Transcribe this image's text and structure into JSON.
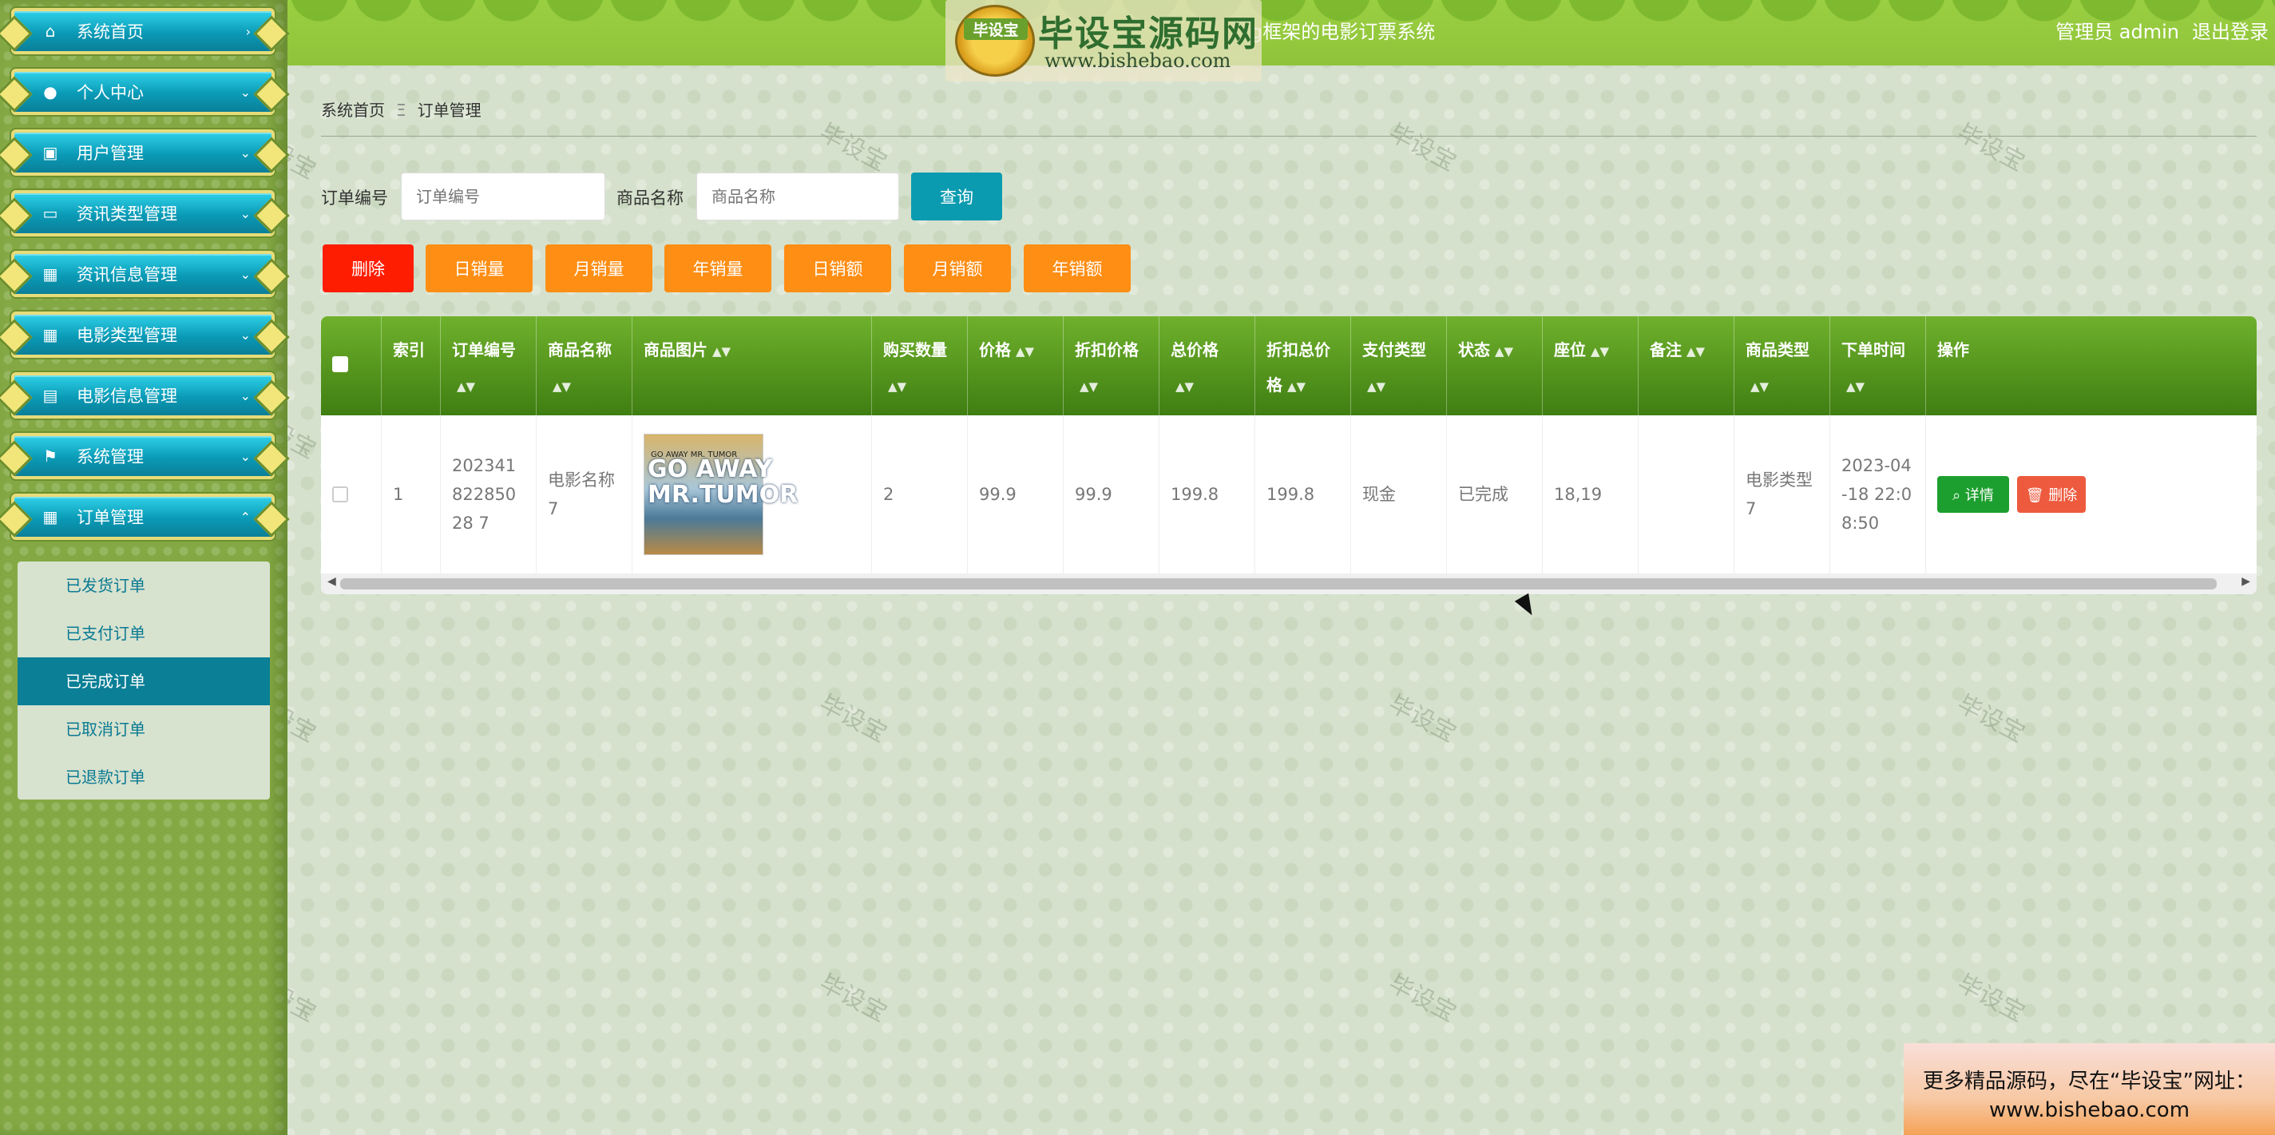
{
  "header": {
    "system_title": "g框架的电影订票系统",
    "admin_label": "管理员 admin",
    "logout": "退出登录"
  },
  "logo": {
    "badge": "毕设宝",
    "title": "毕设宝源码网",
    "url": "www.bishebao.com"
  },
  "sidebar": {
    "items": [
      {
        "label": "系统首页",
        "icon": "home-icon"
      },
      {
        "label": "个人中心",
        "icon": "user-icon"
      },
      {
        "label": "用户管理",
        "icon": "briefcase-icon"
      },
      {
        "label": "资讯类型管理",
        "icon": "monitor-icon"
      },
      {
        "label": "资讯信息管理",
        "icon": "grid-icon"
      },
      {
        "label": "电影类型管理",
        "icon": "grid-icon"
      },
      {
        "label": "电影信息管理",
        "icon": "calendar-check-icon"
      },
      {
        "label": "系统管理",
        "icon": "flag-icon"
      },
      {
        "label": "订单管理",
        "icon": "grid-icon"
      }
    ],
    "submenu": [
      "已发货订单",
      "已支付订单",
      "已完成订单",
      "已取消订单",
      "已退款订单"
    ],
    "active_submenu": "已完成订单"
  },
  "breadcrumb": {
    "home": "系统首页",
    "separator": "Ξ",
    "current": "订单管理"
  },
  "search": {
    "order_no_label": "订单编号",
    "order_no_placeholder": "订单编号",
    "product_label": "商品名称",
    "product_placeholder": "商品名称",
    "query_button": "查询"
  },
  "actions": {
    "delete": "删除",
    "daily_sales_qty": "日销量",
    "monthly_sales_qty": "月销量",
    "yearly_sales_qty": "年销量",
    "daily_sales_amt": "日销额",
    "monthly_sales_amt": "月销额",
    "yearly_sales_amt": "年销额"
  },
  "table": {
    "headers": {
      "index": "索引",
      "order_no": "订单编号",
      "product_name": "商品名称",
      "product_image": "商品图片",
      "quantity": "购买数量",
      "price": "价格",
      "discount_price": "折扣价格",
      "total_price": "总价格",
      "discount_total": "折扣总价格",
      "payment_type": "支付类型",
      "status": "状态",
      "seat": "座位",
      "remark": "备注",
      "product_type": "商品类型",
      "order_time": "下单时间",
      "operation": "操作"
    },
    "rows": [
      {
        "index": "1",
        "order_no": "20234182285028 7",
        "product_name": "电影名称7",
        "poster_text": "GO AWAY MR. TUMOR",
        "quantity": "2",
        "price": "99.9",
        "discount_price": "99.9",
        "total_price": "199.8",
        "discount_total": "199.8",
        "payment_type": "现金",
        "status": "已完成",
        "seat": "18,19",
        "remark": "",
        "product_type": "电影类型7",
        "order_time": "2023-04-18 22:08:50",
        "detail_button": "详情",
        "delete_button": "删除"
      }
    ]
  },
  "watermark": "毕设宝",
  "banner": {
    "line1": "更多精品源码，尽在“毕设宝”网址：",
    "line2": "www.bishebao.com"
  },
  "colors": {
    "sidebar_bg": "#84a944",
    "menu_cyan": "#0a9ab6",
    "header_green": "#9bcf42",
    "table_header": "#3f7e12",
    "danger": "#ff1d02",
    "warning": "#ff8e14",
    "query": "#0b9bb0"
  }
}
